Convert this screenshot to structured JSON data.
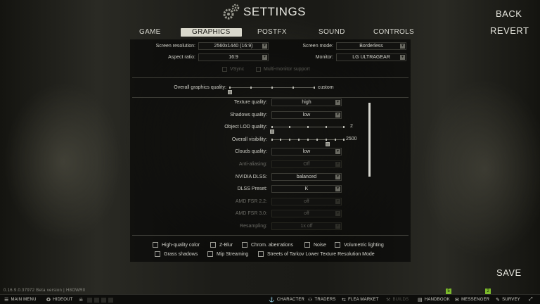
{
  "header": {
    "title": "SETTINGS"
  },
  "actions": {
    "back": "BACK",
    "revert": "REVERT",
    "save": "SAVE"
  },
  "tabs": [
    {
      "label": "GAME",
      "active": false
    },
    {
      "label": "GRAPHICS",
      "active": true
    },
    {
      "label": "POSTFX",
      "active": false
    },
    {
      "label": "SOUND",
      "active": false
    },
    {
      "label": "CONTROLS",
      "active": false
    }
  ],
  "display": {
    "screen_resolution": {
      "label": "Screen resolution:",
      "value": "2560x1440 (16:9)"
    },
    "aspect_ratio": {
      "label": "Aspect ratio:",
      "value": "16:9"
    },
    "screen_mode": {
      "label": "Screen mode:",
      "value": "Borderless"
    },
    "monitor": {
      "label": "Monitor:",
      "value": "LG ULTRAGEAR"
    },
    "vsync": "VSync",
    "multi_monitor": "Multi-monitor support"
  },
  "overall_quality": {
    "label": "Overall graphics quality:",
    "value": "custom"
  },
  "settings": {
    "texture_quality": {
      "label": "Texture quality:",
      "value": "high"
    },
    "shadows_quality": {
      "label": "Shadows quality:",
      "value": "low"
    },
    "object_lod": {
      "label": "Object LOD quality:",
      "value": "2"
    },
    "overall_visibility": {
      "label": "Overall visibility:",
      "value": "2500"
    },
    "clouds_quality": {
      "label": "Clouds quality:",
      "value": "low"
    },
    "anti_aliasing": {
      "label": "Anti-aliasing:",
      "value": "Off"
    },
    "nvidia_dlss": {
      "label": "NVIDIA DLSS:",
      "value": "balanced"
    },
    "dlss_preset": {
      "label": "DLSS Preset:",
      "value": "K"
    },
    "amd_fsr22": {
      "label": "AMD FSR 2.2:",
      "value": "off"
    },
    "amd_fsr30": {
      "label": "AMD FSR 3.0:",
      "value": "off"
    },
    "resampling": {
      "label": "Resampling:",
      "value": "1x off"
    }
  },
  "checkboxes": {
    "hq_color": "High-quality color",
    "zblur": "Z-Blur",
    "chrom": "Chrom. aberrations",
    "noise": "Noise",
    "volumetric": "Volumetric lighting",
    "grass_shadows": "Grass shadows",
    "mip_streaming": "Mip Streaming",
    "streets_lowres": "Streets of Tarkov Lower Texture Resolution Mode"
  },
  "footer": {
    "version": "0.16.9.0.37972 Beta version | H8OWR0",
    "main_menu": "MAIN MENU",
    "hideout": "HIDEOUT",
    "character": "CHARACTER",
    "traders": "TRADERS",
    "flea_market": "FLEA MARKET",
    "builds": "BUILDS",
    "handbook": "HANDBOOK",
    "messenger": "MESSENGER",
    "survey": "SURVEY",
    "handbook_badge": "5",
    "messenger_badge": "2"
  },
  "colors": {
    "accent_active_tab": "#d9d8cc",
    "badge_green": "#7dbb2c"
  }
}
